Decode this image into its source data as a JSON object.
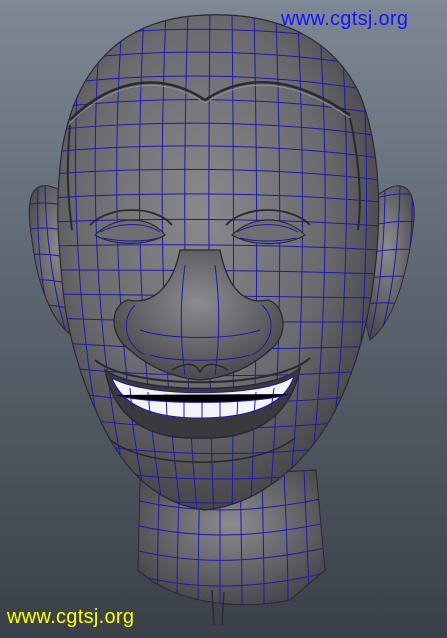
{
  "watermark": {
    "top_text": "www.cgtsj.org",
    "bottom_text": "www.cgtsj.org",
    "top_color": "#1414ff",
    "bottom_color": "#ffff00"
  },
  "viewport": {
    "background_top": "#7d8894",
    "background_bottom": "#3a4048",
    "model": "cartoon-head-wireframe",
    "wireframe_color": "#1b1ba8",
    "shaded_color": "#6e6e72"
  }
}
